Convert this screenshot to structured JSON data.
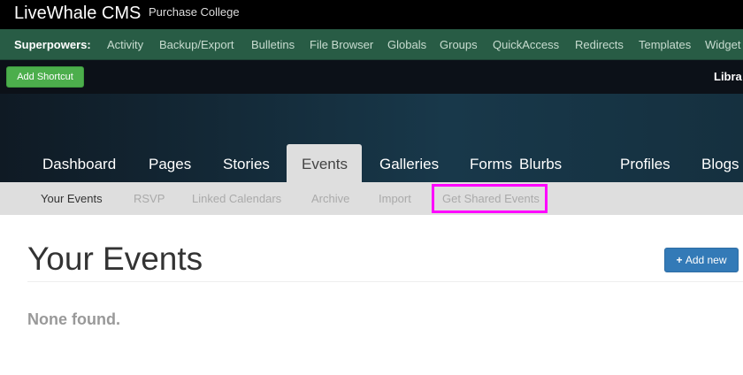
{
  "header": {
    "app_title": "LiveWhale CMS",
    "site_name": "Purchase College"
  },
  "superpowers": {
    "label": "Superpowers:",
    "items": [
      "Activity",
      "Backup/Export",
      "Bulletins",
      "File Browser",
      "Globals",
      "Groups",
      "QuickAccess",
      "Redirects",
      "Templates",
      "Widget"
    ]
  },
  "toolbar": {
    "add_shortcut": "Add Shortcut",
    "right_link": "Libra"
  },
  "nav": {
    "tabs": [
      "Dashboard",
      "Pages",
      "Stories",
      "Events",
      "Galleries",
      "Forms",
      "Blurbs",
      "Profiles",
      "Blogs"
    ],
    "active": "Events"
  },
  "subnav": {
    "items": [
      "Your Events",
      "RSVP",
      "Linked Calendars",
      "Archive",
      "Import",
      "Get Shared Events"
    ],
    "active": "Your Events",
    "highlighted": "Get Shared Events",
    "highlight_color": "#ff00ff"
  },
  "main": {
    "title": "Your Events",
    "add_new": "Add new",
    "empty": "None found."
  }
}
